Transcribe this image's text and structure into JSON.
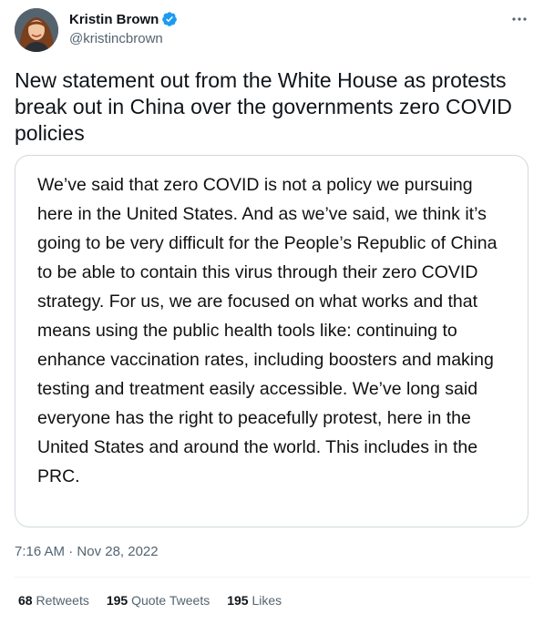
{
  "author": {
    "display_name": "Kristin Brown",
    "handle": "@kristincbrown",
    "verified": true
  },
  "tweet": {
    "text": "New statement out from the White House as protests break out in China over the governments zero COVID policies",
    "attached_image_text": "We’ve said that zero COVID is not a policy we pursuing here in the United States. And as we’ve said, we think it’s going to be very difficult for the People’s Republic of China to be able to contain this virus through their zero COVID strategy. For us, we are focused on what works and that means using the public health tools like: continuing to enhance vaccination rates, including boosters and making testing and treatment easily accessible. We’ve long said everyone has the right to peacefully protest, here in the United States and around the world. This includes in the PRC.",
    "time": "7:16 AM",
    "separator": "·",
    "date": "Nov 28, 2022"
  },
  "stats": {
    "retweets": {
      "count": "68",
      "label": "Retweets"
    },
    "quote_tweets": {
      "count": "195",
      "label": "Quote Tweets"
    },
    "likes": {
      "count": "195",
      "label": "Likes"
    }
  },
  "icons": {
    "verified": "verified-badge-icon",
    "more": "more-options-icon"
  },
  "colors": {
    "verified_blue": "#1d9bf0",
    "secondary_text": "#536471",
    "border": "#cfd9de"
  }
}
